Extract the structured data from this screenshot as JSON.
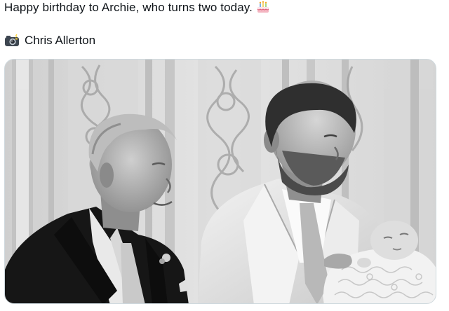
{
  "tweet": {
    "text": "Happy birthday to Archie, who turns two today.",
    "text_emoji": "birthday-cake-icon",
    "credit_emoji": "camera-with-flash-icon",
    "credit": "Chris Allerton"
  },
  "media": {
    "type": "photo",
    "colors": {
      "wall": "#dedede",
      "suit_dark": "#1a1a1a",
      "suit_light": "#e6e6e6",
      "hair_gray": "#bdbdbd",
      "hair_dark": "#3a3a3a"
    }
  }
}
